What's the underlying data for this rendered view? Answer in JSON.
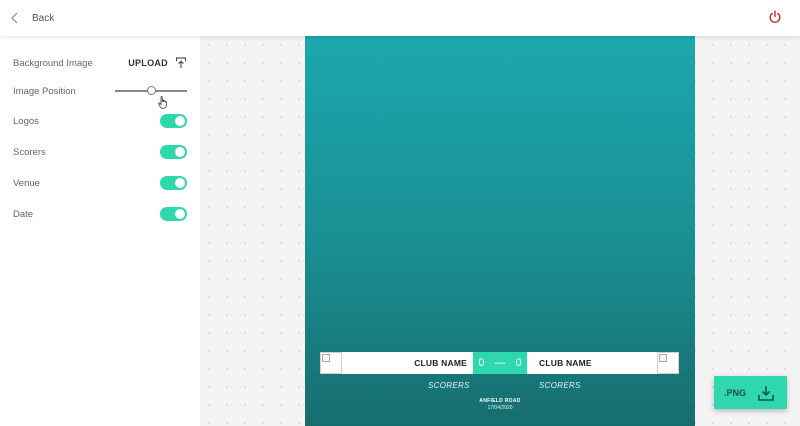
{
  "topbar": {
    "back_label": "Back"
  },
  "sidebar": {
    "background_image": {
      "label": "Background Image",
      "upload_label": "UPLOAD"
    },
    "image_position": {
      "label": "Image Position",
      "value": 0.5
    },
    "toggles": [
      {
        "label": "Logos",
        "on": true
      },
      {
        "label": "Scorers",
        "on": true
      },
      {
        "label": "Venue",
        "on": true
      },
      {
        "label": "Date",
        "on": true
      }
    ]
  },
  "poster": {
    "home": {
      "name": "CLUB NAME",
      "score": "0",
      "scorers": "SCORERS"
    },
    "away": {
      "name": "CLUB NAME",
      "score": "0",
      "scorers": "SCORERS"
    },
    "separator": "—",
    "venue": "ANFIELD ROAD",
    "date": "17/04/2020"
  },
  "download": {
    "label": ".PNG"
  },
  "colors": {
    "accent": "#2fd8ac",
    "poster_top": "#1ba8ad",
    "poster_bottom": "#176d6e",
    "power": "#c62828"
  }
}
